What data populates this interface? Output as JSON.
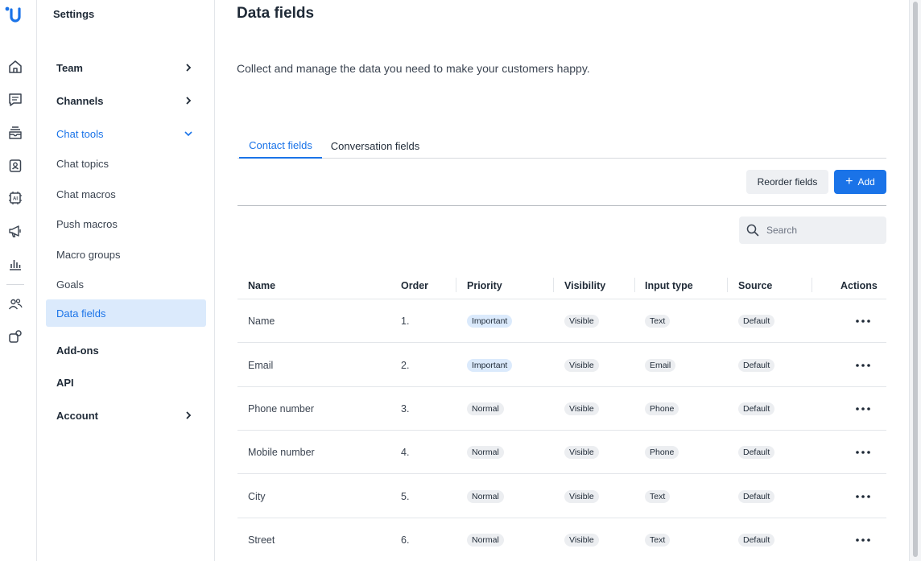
{
  "nav": {
    "title": "Settings",
    "items": [
      {
        "label": "Team"
      },
      {
        "label": "Channels"
      },
      {
        "label": "Chat tools"
      },
      {
        "label": "Chat topics"
      },
      {
        "label": "Chat macros"
      },
      {
        "label": "Push macros"
      },
      {
        "label": "Macro groups"
      },
      {
        "label": "Goals"
      },
      {
        "label": "Data fields"
      },
      {
        "label": "Add-ons"
      },
      {
        "label": "API"
      },
      {
        "label": "Account"
      }
    ]
  },
  "rail_icons": [
    "home-icon",
    "conversations-icon",
    "inbox-icon",
    "contacts-icon",
    "ai-icon",
    "campaigns-icon",
    "reports-icon",
    "team-icon",
    "integrations-icon"
  ],
  "header": {
    "title": "Data fields",
    "subtitle": "Collect and manage the data you need to make your customers happy."
  },
  "tabs": [
    {
      "label": "Contact fields",
      "active": true
    },
    {
      "label": "Conversation fields",
      "active": false
    }
  ],
  "toolbar": {
    "reorder_label": "Reorder fields",
    "add_label": "Add"
  },
  "search": {
    "placeholder": "Search",
    "value": ""
  },
  "table": {
    "columns": [
      "Name",
      "Order",
      "Priority",
      "Visibility",
      "Input type",
      "Source",
      "Actions"
    ],
    "rows": [
      {
        "name": "Name",
        "order": "1.",
        "priority": "Important",
        "visibility": "Visible",
        "input_type": "Text",
        "source": "Default"
      },
      {
        "name": "Email",
        "order": "2.",
        "priority": "Important",
        "visibility": "Visible",
        "input_type": "Email",
        "source": "Default"
      },
      {
        "name": "Phone number",
        "order": "3.",
        "priority": "Normal",
        "visibility": "Visible",
        "input_type": "Phone",
        "source": "Default"
      },
      {
        "name": "Mobile number",
        "order": "4.",
        "priority": "Normal",
        "visibility": "Visible",
        "input_type": "Phone",
        "source": "Default"
      },
      {
        "name": "City",
        "order": "5.",
        "priority": "Normal",
        "visibility": "Visible",
        "input_type": "Text",
        "source": "Default"
      },
      {
        "name": "Street",
        "order": "6.",
        "priority": "Normal",
        "visibility": "Visible",
        "input_type": "Text",
        "source": "Default"
      }
    ]
  },
  "colors": {
    "accent": "#1a73e8",
    "selected_bg": "#dbeafc",
    "badge_bg": "#eceef1"
  }
}
